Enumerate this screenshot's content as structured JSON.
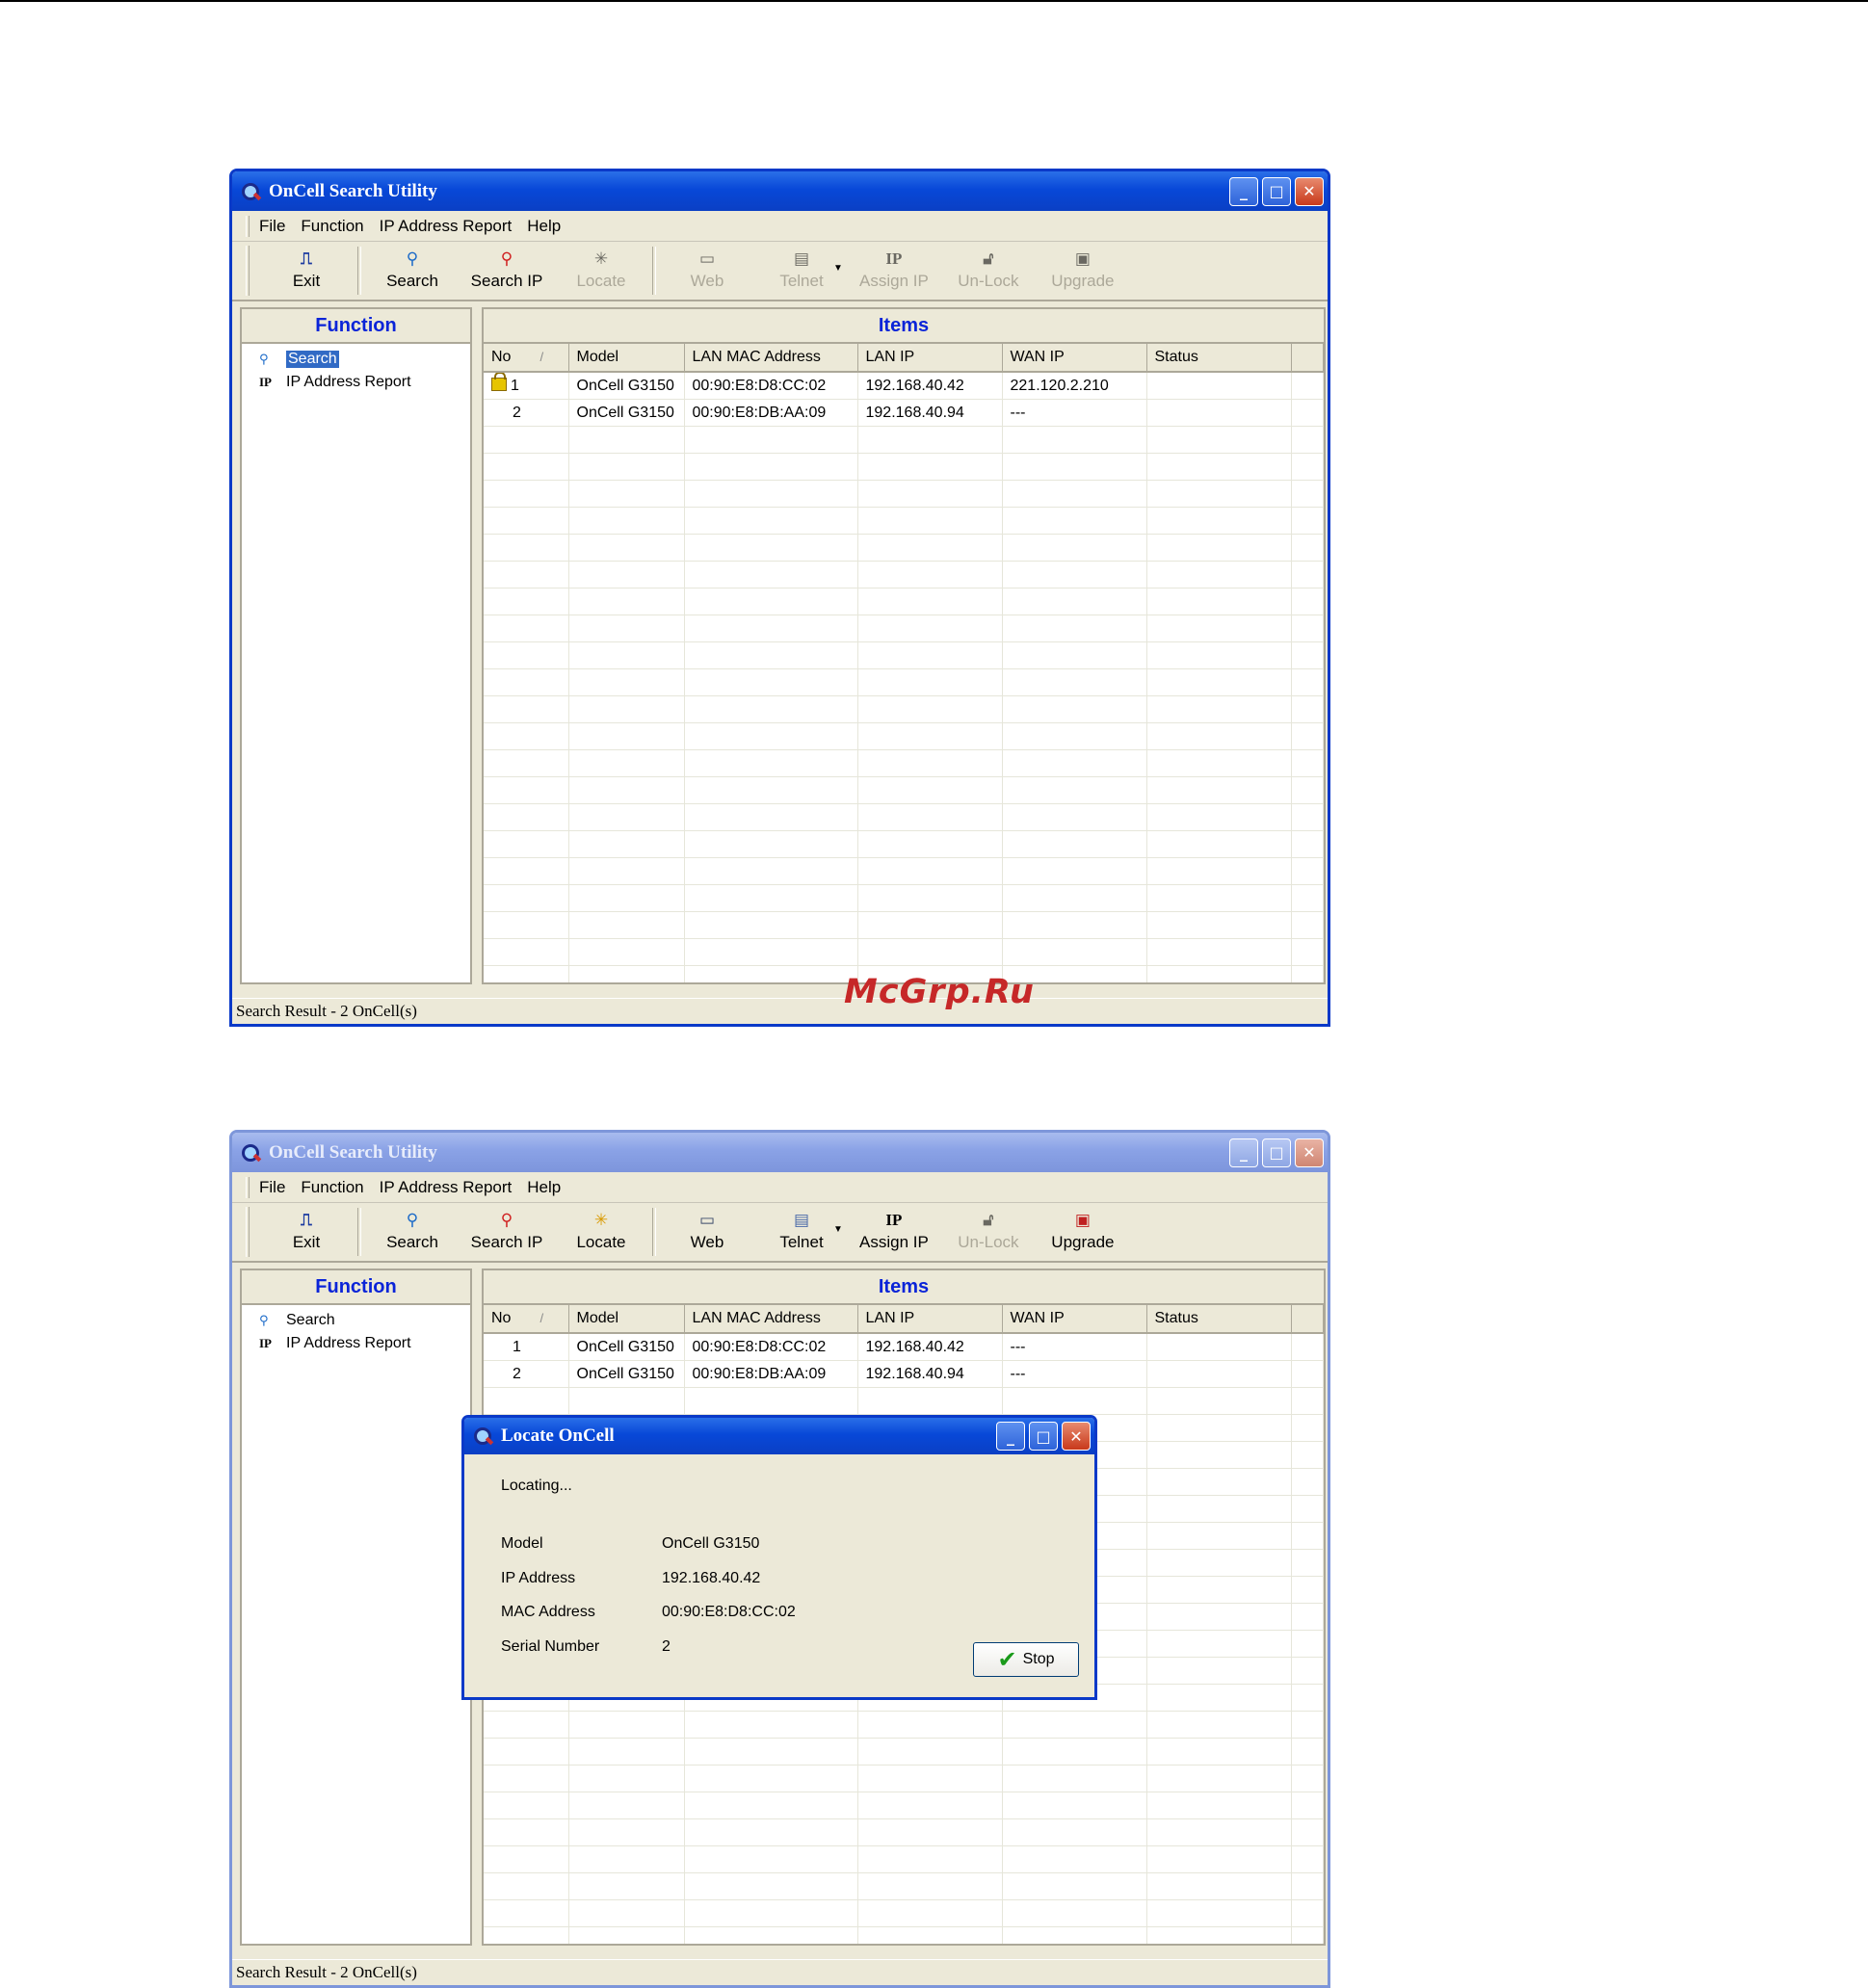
{
  "app_title": "OnCell Search Utility",
  "menu": [
    "File",
    "Function",
    "IP Address Report",
    "Help"
  ],
  "toolbar_w1": [
    {
      "label": "Exit",
      "icon": "exit-icon",
      "enabled": true
    },
    {
      "label": "Search",
      "icon": "search-icon",
      "enabled": true
    },
    {
      "label": "Search IP",
      "icon": "search-ip-icon",
      "enabled": true
    },
    {
      "label": "Locate",
      "icon": "locate-icon",
      "enabled": false
    },
    {
      "label": "Web",
      "icon": "web-icon",
      "enabled": false
    },
    {
      "label": "Telnet",
      "icon": "telnet-icon",
      "enabled": false
    },
    {
      "label": "Assign IP",
      "icon": "assign-ip-icon",
      "enabled": false
    },
    {
      "label": "Un-Lock",
      "icon": "unlock-icon",
      "enabled": false
    },
    {
      "label": "Upgrade",
      "icon": "upgrade-icon",
      "enabled": false
    }
  ],
  "toolbar_w2": [
    {
      "label": "Exit",
      "icon": "exit-icon",
      "enabled": true
    },
    {
      "label": "Search",
      "icon": "search-icon",
      "enabled": true
    },
    {
      "label": "Search IP",
      "icon": "search-ip-icon",
      "enabled": true
    },
    {
      "label": "Locate",
      "icon": "locate-icon",
      "enabled": true
    },
    {
      "label": "Web",
      "icon": "web-icon",
      "enabled": true
    },
    {
      "label": "Telnet",
      "icon": "telnet-icon",
      "enabled": true
    },
    {
      "label": "Assign IP",
      "icon": "assign-ip-icon",
      "enabled": true
    },
    {
      "label": "Un-Lock",
      "icon": "unlock-icon",
      "enabled": false
    },
    {
      "label": "Upgrade",
      "icon": "upgrade-icon",
      "enabled": true
    }
  ],
  "function_panel": {
    "title": "Function",
    "items": [
      "Search",
      "IP Address Report"
    ]
  },
  "items_panel": {
    "title": "Items",
    "columns": [
      "No",
      "Model",
      "LAN MAC Address",
      "LAN IP",
      "WAN IP",
      "Status"
    ],
    "rows_w1": [
      {
        "no": "1",
        "model": "OnCell G3150",
        "mac": "00:90:E8:D8:CC:02",
        "lan_ip": "192.168.40.42",
        "wan_ip": "221.120.2.210",
        "status": "",
        "locked": true
      },
      {
        "no": "2",
        "model": "OnCell G3150",
        "mac": "00:90:E8:DB:AA:09",
        "lan_ip": "192.168.40.94",
        "wan_ip": "---",
        "status": "",
        "locked": false
      }
    ],
    "rows_w2": [
      {
        "no": "1",
        "model": "OnCell G3150",
        "mac": "00:90:E8:D8:CC:02",
        "lan_ip": "192.168.40.42",
        "wan_ip": "---",
        "status": "",
        "locked": false
      },
      {
        "no": "2",
        "model": "OnCell G3150",
        "mac": "00:90:E8:DB:AA:09",
        "lan_ip": "192.168.40.94",
        "wan_ip": "---",
        "status": "",
        "locked": false
      }
    ]
  },
  "status_text": "Search Result - 2 OnCell(s)",
  "watermark": "McGrp.Ru",
  "locate_dialog": {
    "title": "Locate OnCell",
    "status": "Locating...",
    "fields": [
      {
        "label": "Model",
        "value": "OnCell G3150"
      },
      {
        "label": "IP Address",
        "value": "192.168.40.42"
      },
      {
        "label": "MAC Address",
        "value": "00:90:E8:D8:CC:02"
      },
      {
        "label": "Serial Number",
        "value": "2"
      }
    ],
    "stop_label": "Stop"
  },
  "colors": {
    "title_active": "#0848d8",
    "title_inactive": "#8aa2e6",
    "panel_heading": "#0a24d8",
    "watermark": "#c62828"
  }
}
